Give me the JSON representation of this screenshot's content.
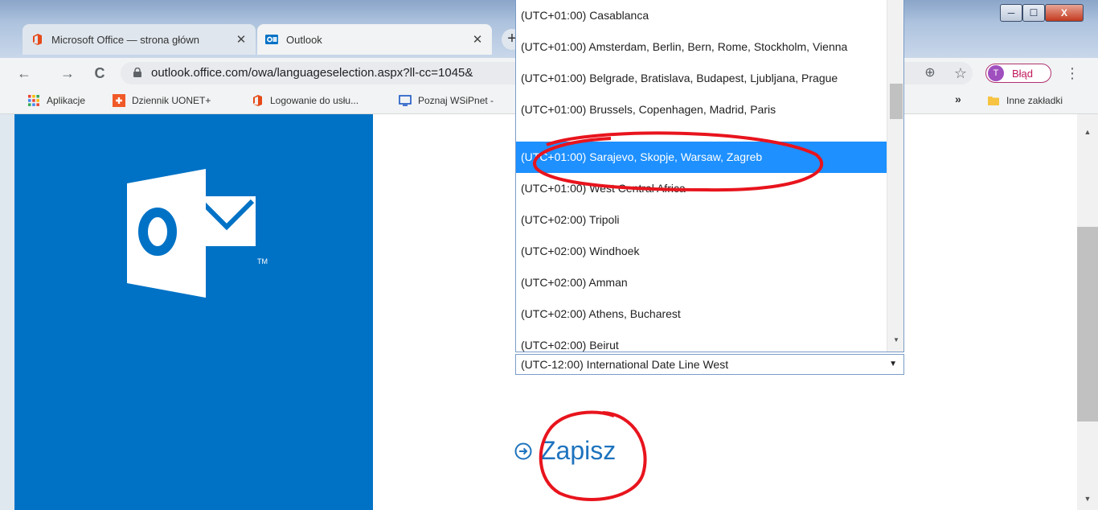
{
  "window": {
    "minimize": "─",
    "maximize": "☐",
    "close": "X"
  },
  "tabs": [
    {
      "title": "Microsoft Office — strona główn",
      "close": "✕"
    },
    {
      "title": "Outlook",
      "close": "✕"
    }
  ],
  "new_tab": "+",
  "toolbar": {
    "back": "←",
    "forward": "→",
    "reload": "C",
    "url": "outlook.office.com/owa/languageselection.aspx?ll-cc=1045&",
    "zoom": "⊕",
    "star": "☆",
    "profile_initial": "T",
    "profile_label": "Błąd",
    "menu": "⋮"
  },
  "bookmarks": {
    "items": [
      {
        "label": "Aplikacje"
      },
      {
        "label": "Dziennik UONET+"
      },
      {
        "label": "Logowanie do usłu..."
      },
      {
        "label": "Poznaj WSiPnet -"
      }
    ],
    "more": "»",
    "other": "Inne zakładki"
  },
  "timezone_dropdown": {
    "options": [
      "(UTC+01:00) Casablanca",
      "(UTC+01:00) Amsterdam, Berlin, Bern, Rome, Stockholm, Vienna",
      "(UTC+01:00) Belgrade, Bratislava, Budapest, Ljubljana, Prague",
      "(UTC+01:00) Brussels, Copenhagen, Madrid, Paris",
      "(UTC+01:00) Sarajevo, Skopje, Warsaw, Zagreb",
      "(UTC+01:00) West Central Africa",
      "(UTC+02:00) Tripoli",
      "(UTC+02:00) Windhoek",
      "(UTC+02:00) Amman",
      "(UTC+02:00) Athens, Bucharest",
      "(UTC+02:00) Beirut"
    ],
    "highlighted_index": 4,
    "current_value": "(UTC-12:00) International Date Line West"
  },
  "save_button": {
    "label": "Zapisz"
  },
  "logo": {
    "trademark": "TM"
  },
  "colors": {
    "outlook_blue": "#0072c6",
    "selection_blue": "#1e90ff",
    "annotation_red": "#e8141d"
  }
}
